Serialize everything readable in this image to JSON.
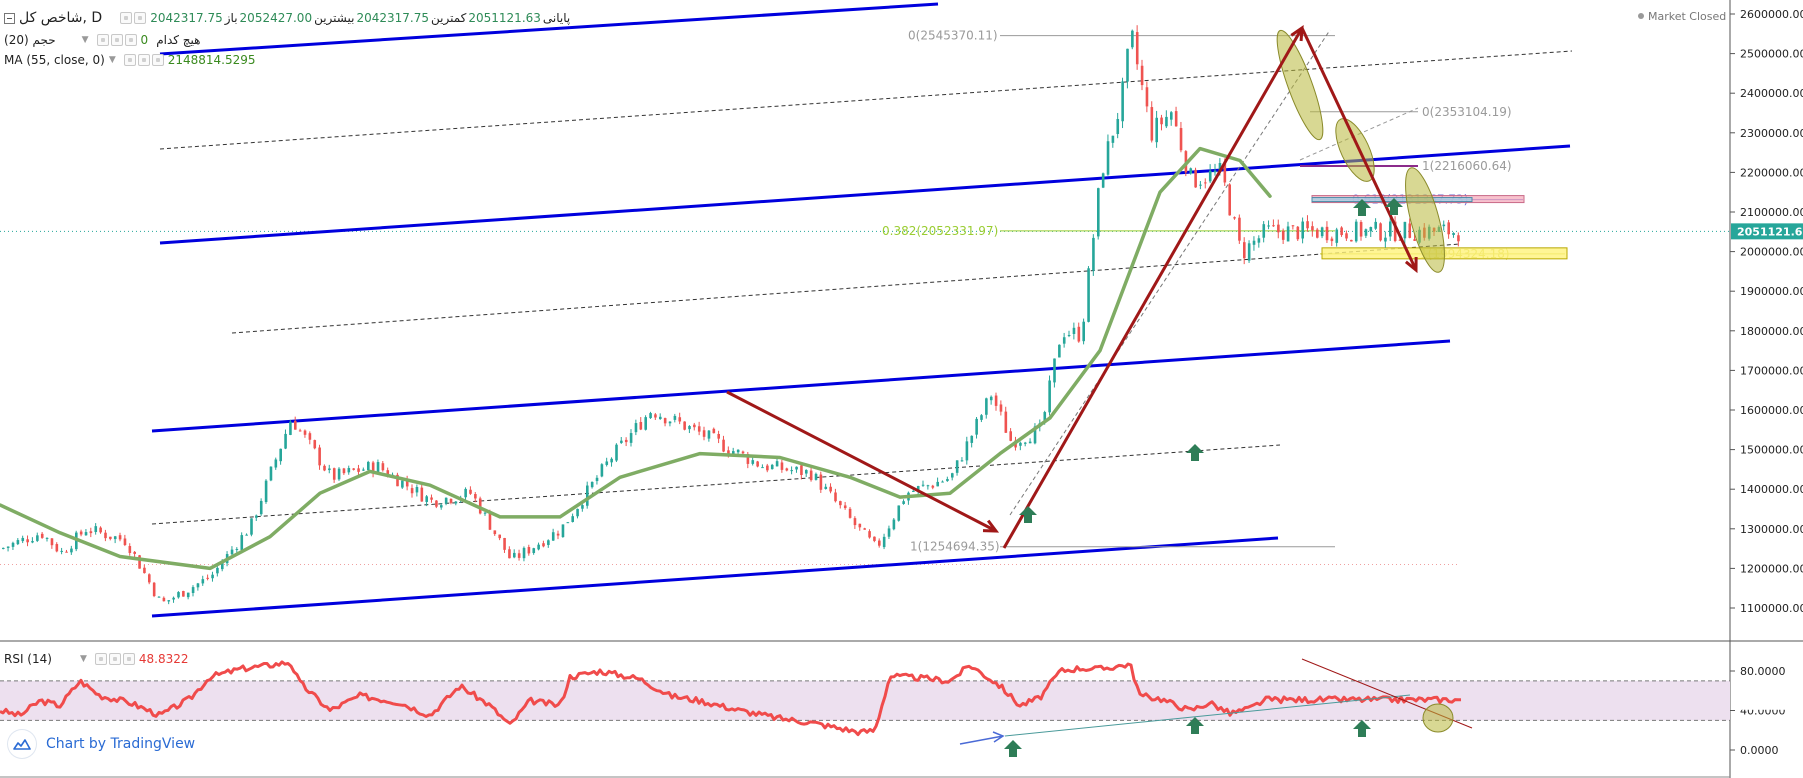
{
  "legend": {
    "main": {
      "symbol": "شاخص کل, D",
      "open_label": "باز",
      "open": "2042317.75",
      "high_label": "بیشترین",
      "high": "2052427.00",
      "low_label": "کمترین",
      "low": "2042317.75",
      "close_label": "پایانی",
      "close": "2051121.63"
    },
    "volume": {
      "name": "حجم (20)",
      "none_label": "هیچ کدام",
      "value": "0"
    },
    "ma": {
      "name": "MA (55, close, 0)",
      "value": "2148814.5295"
    },
    "rsi": {
      "name": "RSI (14)",
      "value": "48.8322"
    }
  },
  "market_status": "Market Closed",
  "branding": {
    "text": "Chart by TradingView",
    "icon": "tradingview-cloud-icon"
  },
  "colors": {
    "up": "#26a69a",
    "down": "#ef5350",
    "ma": "#7fac64",
    "trend_channel": "#0000dd",
    "arrow": "#a01818",
    "rsi_line": "#f04b4b",
    "rsi_band": "#ede0ef",
    "fib_text": "#9a9a9a",
    "fib_382": "#9acd32",
    "signal_arrow": "#2e7d57",
    "price_tag": "#26a69a"
  },
  "chart_data": [
    {
      "type": "candlestick",
      "interval": "D",
      "ylim": [
        1050000,
        2620000
      ],
      "yticks": [
        "1100000.00",
        "1200000.00",
        "1300000.00",
        "1400000.00",
        "1500000.00",
        "1600000.00",
        "1700000.00",
        "1800000.00",
        "1900000.00",
        "2000000.00",
        "2100000.00",
        "2200000.00",
        "2300000.00",
        "2400000.00",
        "2500000.00",
        "2600000.00"
      ],
      "last_price": "2051121.63",
      "price_path": [
        [
          0,
          1250000
        ],
        [
          40,
          1290000
        ],
        [
          60,
          1240000
        ],
        [
          85,
          1300000
        ],
        [
          125,
          1270000
        ],
        [
          160,
          1110000
        ],
        [
          210,
          1180000
        ],
        [
          250,
          1310000
        ],
        [
          290,
          1580000
        ],
        [
          330,
          1430000
        ],
        [
          375,
          1460000
        ],
        [
          430,
          1370000
        ],
        [
          470,
          1390000
        ],
        [
          510,
          1220000
        ],
        [
          560,
          1300000
        ],
        [
          610,
          1480000
        ],
        [
          650,
          1600000
        ],
        [
          700,
          1540000
        ],
        [
          760,
          1460000
        ],
        [
          810,
          1440000
        ],
        [
          850,
          1320000
        ],
        [
          875,
          1250000
        ],
        [
          905,
          1390000
        ],
        [
          950,
          1430000
        ],
        [
          990,
          1640000
        ],
        [
          1010,
          1520000
        ],
        [
          1040,
          1550000
        ],
        [
          1060,
          1800000
        ],
        [
          1080,
          1790000
        ],
        [
          1100,
          2200000
        ],
        [
          1120,
          2380000
        ],
        [
          1130,
          2545000
        ],
        [
          1150,
          2300000
        ],
        [
          1170,
          2353000
        ],
        [
          1190,
          2180000
        ],
        [
          1220,
          2200000
        ],
        [
          1240,
          1995000
        ],
        [
          1265,
          2051000
        ]
      ],
      "ma_path": [
        [
          0,
          1360000
        ],
        [
          60,
          1290000
        ],
        [
          120,
          1230000
        ],
        [
          210,
          1200000
        ],
        [
          270,
          1280000
        ],
        [
          320,
          1390000
        ],
        [
          370,
          1445000
        ],
        [
          430,
          1410000
        ],
        [
          500,
          1330000
        ],
        [
          560,
          1330000
        ],
        [
          620,
          1430000
        ],
        [
          700,
          1490000
        ],
        [
          780,
          1480000
        ],
        [
          850,
          1430000
        ],
        [
          900,
          1380000
        ],
        [
          950,
          1390000
        ],
        [
          1000,
          1490000
        ],
        [
          1050,
          1580000
        ],
        [
          1100,
          1750000
        ],
        [
          1130,
          1950000
        ],
        [
          1160,
          2150000
        ],
        [
          1200,
          2260000
        ],
        [
          1240,
          2230000
        ],
        [
          1270,
          2140000
        ]
      ],
      "fibonacci": [
        {
          "label": "0(2545370.11)",
          "price": 2545370.11
        },
        {
          "label": "1(1254694.35)",
          "price": 1254694.35
        },
        {
          "label": "0.382(2052331.97)",
          "price": 2052331.97
        },
        {
          "label": "0(2353104.19)",
          "price": 2353104.19
        },
        {
          "label": "1(2216060.64)",
          "price": 2216060.64
        },
        {
          "label": "0.618(2131367.73)",
          "price": 2131367.73
        },
        {
          "label": "1(1994324.18)",
          "price": 1994324.18
        }
      ]
    },
    {
      "type": "line",
      "name": "RSI (14)",
      "ylim": [
        -5,
        97
      ],
      "yticks": [
        "0.0000",
        "40.0000",
        "80.0000"
      ],
      "bands": [
        30,
        70
      ],
      "current": 48.8322,
      "rsi_path": [
        [
          0,
          40
        ],
        [
          20,
          35
        ],
        [
          40,
          50
        ],
        [
          60,
          45
        ],
        [
          80,
          70
        ],
        [
          100,
          55
        ],
        [
          130,
          48
        ],
        [
          160,
          35
        ],
        [
          190,
          52
        ],
        [
          210,
          74
        ],
        [
          240,
          82
        ],
        [
          270,
          86
        ],
        [
          290,
          89
        ],
        [
          300,
          68
        ],
        [
          330,
          40
        ],
        [
          360,
          55
        ],
        [
          400,
          48
        ],
        [
          430,
          35
        ],
        [
          460,
          65
        ],
        [
          490,
          45
        ],
        [
          510,
          25
        ],
        [
          530,
          50
        ],
        [
          560,
          45
        ],
        [
          570,
          74
        ],
        [
          600,
          80
        ],
        [
          640,
          72
        ],
        [
          670,
          55
        ],
        [
          700,
          50
        ],
        [
          740,
          40
        ],
        [
          780,
          32
        ],
        [
          810,
          28
        ],
        [
          840,
          22
        ],
        [
          860,
          18
        ],
        [
          875,
          20
        ],
        [
          890,
          75
        ],
        [
          920,
          73
        ],
        [
          950,
          70
        ],
        [
          970,
          86
        ],
        [
          1000,
          65
        ],
        [
          1020,
          45
        ],
        [
          1040,
          53
        ],
        [
          1060,
          80
        ],
        [
          1080,
          83
        ],
        [
          1100,
          82
        ],
        [
          1130,
          87
        ],
        [
          1140,
          55
        ],
        [
          1160,
          52
        ],
        [
          1190,
          40
        ],
        [
          1210,
          48
        ],
        [
          1230,
          37
        ],
        [
          1250,
          42
        ],
        [
          1265,
          51
        ]
      ]
    }
  ]
}
